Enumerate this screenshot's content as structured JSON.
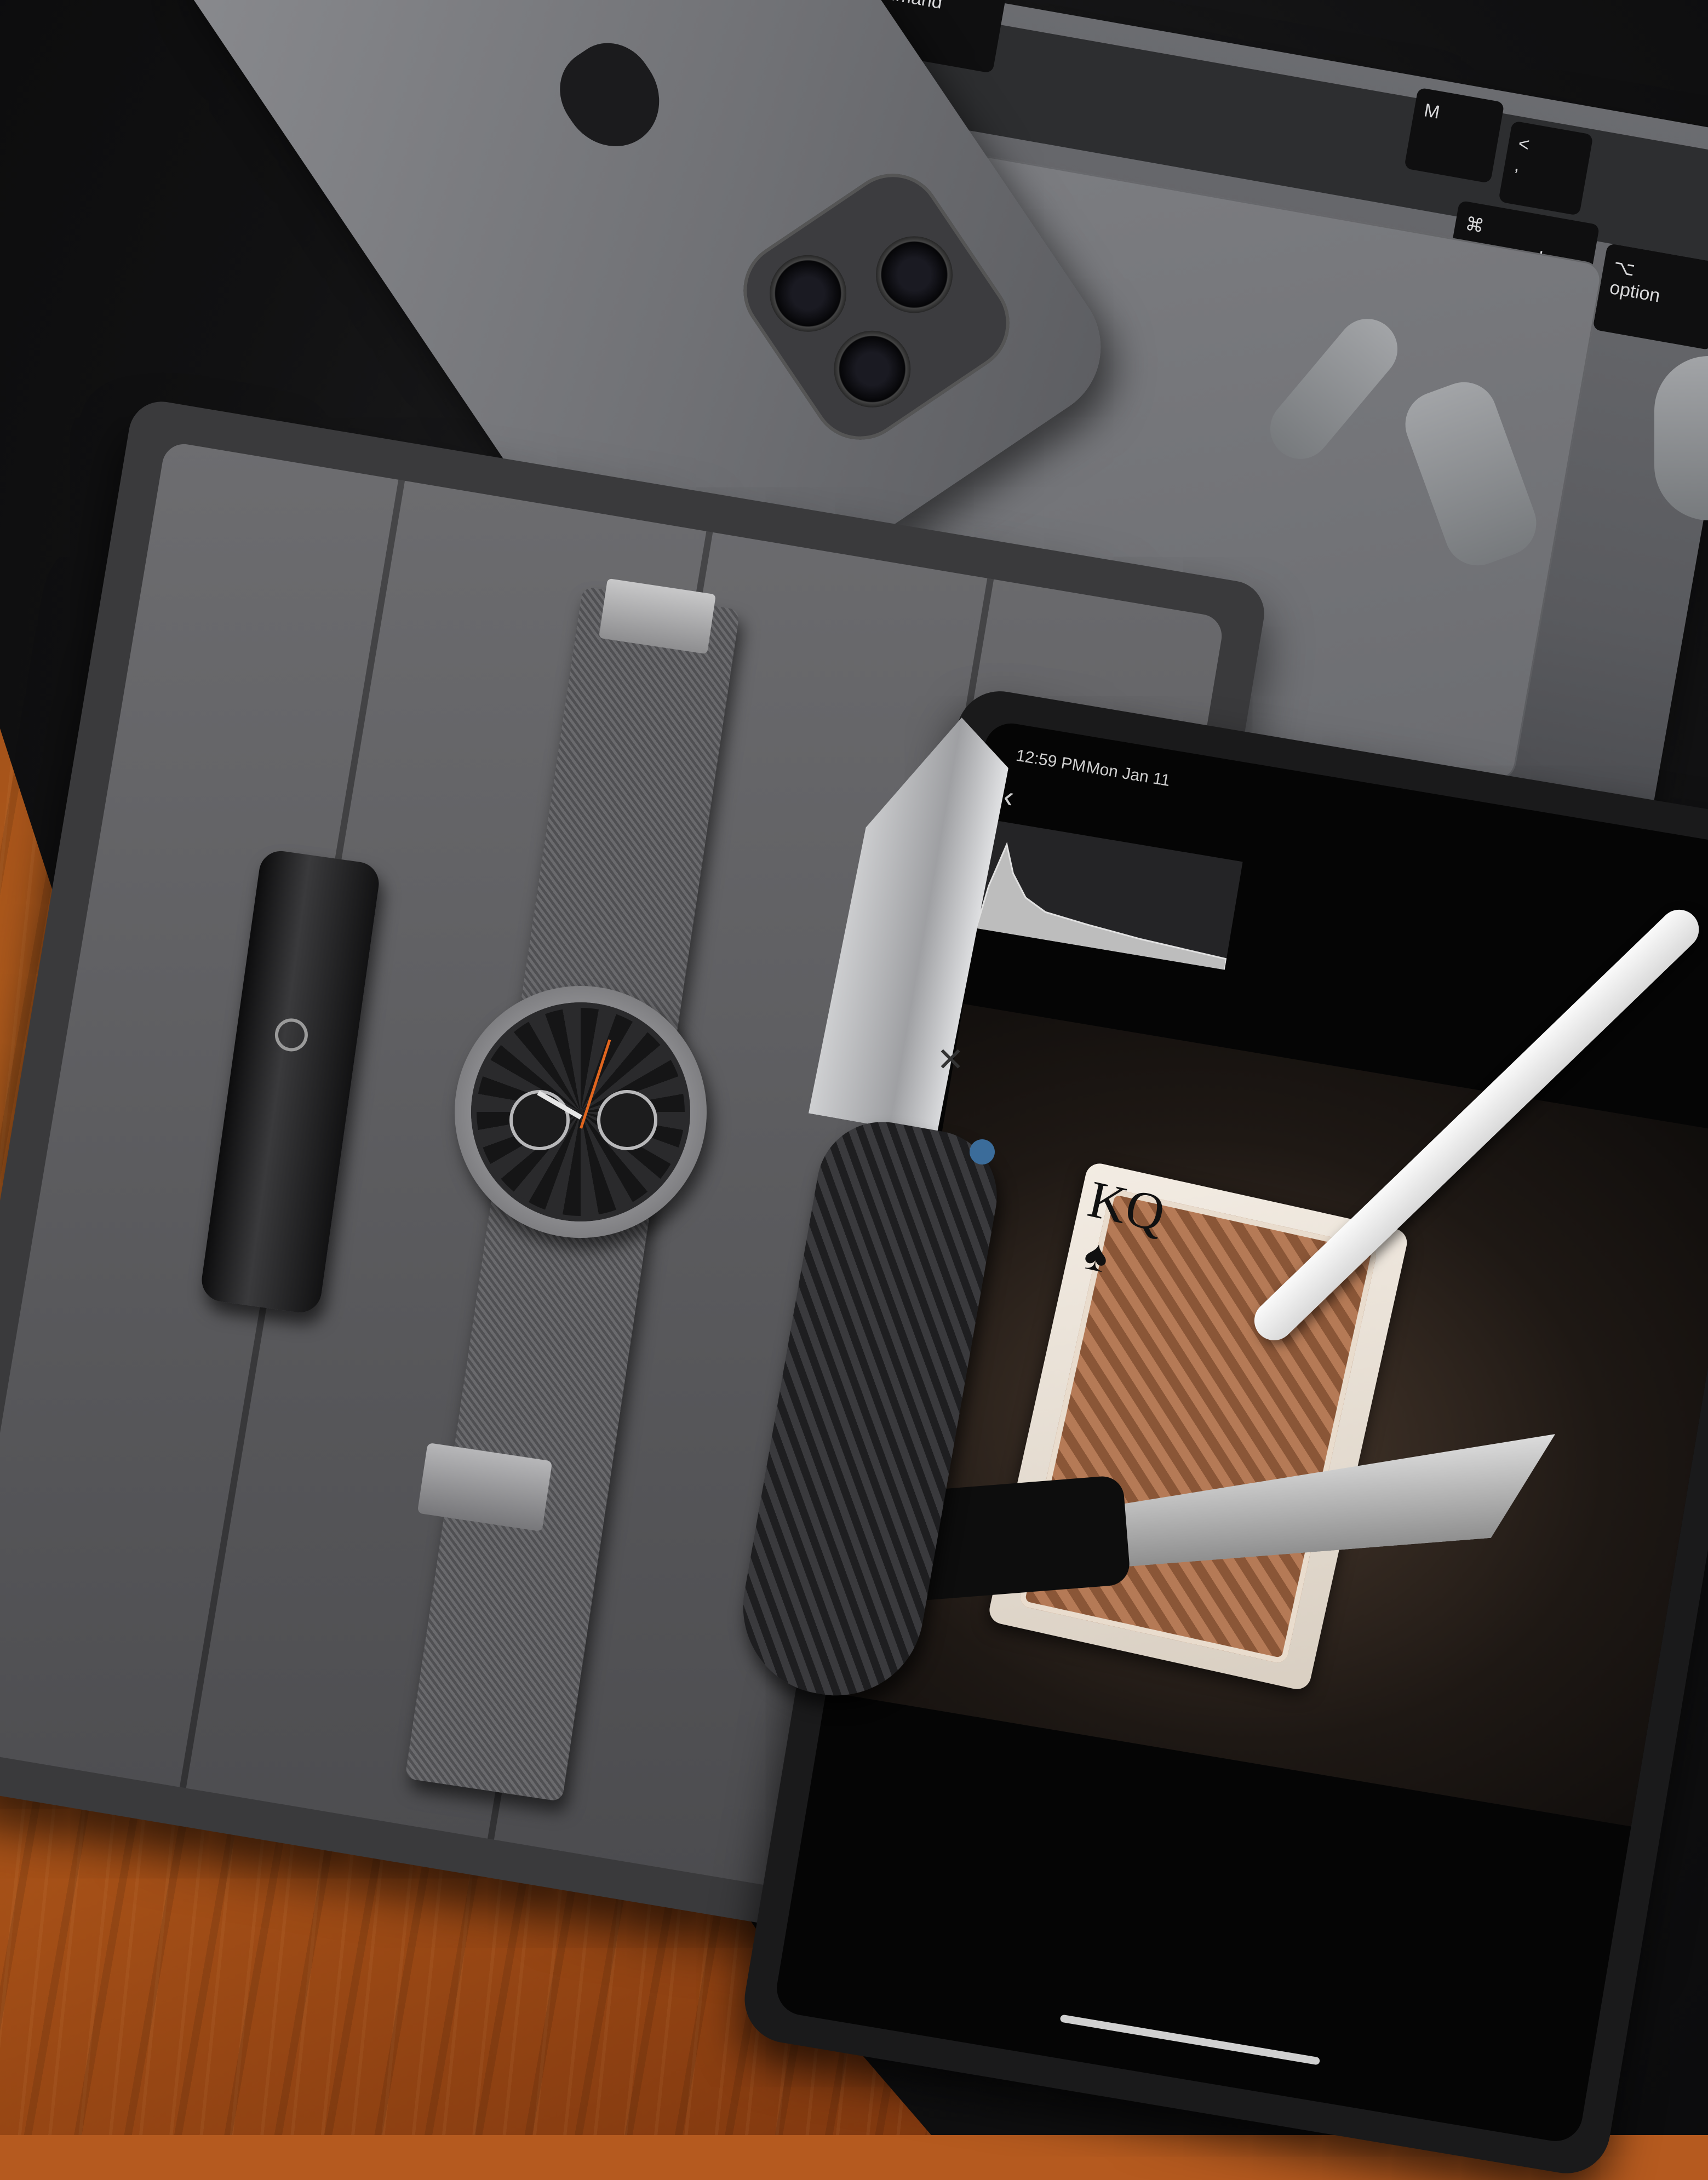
{
  "laptop": {
    "keys": [
      {
        "label": "command",
        "symbol": ""
      },
      {
        "label": "M",
        "symbol": ""
      },
      {
        "label": "<",
        "symbol": ","
      },
      {
        "label": "command",
        "symbol": "⌘"
      },
      {
        "label": "option",
        "symbol": "⌥"
      }
    ]
  },
  "tablet": {
    "status_time": "12:59 PM",
    "status_date": "Mon Jan 11",
    "back_symbol": "‹"
  },
  "photo_card": {
    "rank": "KQ",
    "suit": "♠"
  },
  "colors": {
    "desk": "#111112",
    "floor": "#b8611f",
    "case_felt": "#5e5e61",
    "watch_accent": "#e0651e",
    "knife_screw": "#3b6c9a"
  },
  "icons": [
    "apple-logo-icon",
    "butterfly-logo-icon",
    "flashlight-brand-icon"
  ]
}
